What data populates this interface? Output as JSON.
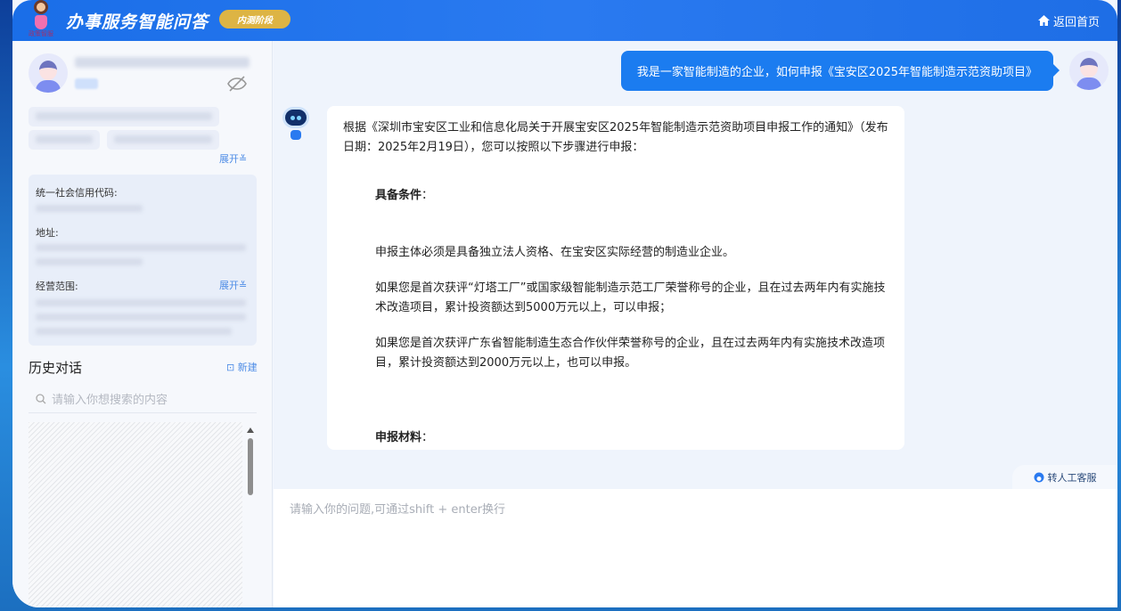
{
  "header": {
    "logo_text": "政策智服",
    "title": "办事服务智能问答",
    "badge": "内测阶段",
    "home_label": "返回首页"
  },
  "sidebar": {
    "credit_code_label": "统一社会信用代码:",
    "address_label": "地址:",
    "scope_label": "经营范围:",
    "expand_label": "展开",
    "history_title": "历史对话",
    "new_label": "新建",
    "search_placeholder": "请输入你想搜索的内容"
  },
  "chat": {
    "user_message": "我是一家智能制造的企业，如何申报《宝安区2025年智能制造示范资助项目》",
    "answer": {
      "intro": "根据《深圳市宝安区工业和信息化局关于开展宝安区2025年智能制造示范资助项目申报工作的通知》（发布日期：2025年2月19日），您可以按照以下步骤进行申报：",
      "section1_title": "具备条件",
      "section1_colon": "：",
      "p1": "申报主体必须是具备独立法人资格、在宝安区实际经营的制造业企业。",
      "p2": "如果您是首次获评“灯塔工厂”或国家级智能制造示范工厂荣誉称号的企业，且在过去两年内有实施技术改造项目，累计投资额达到5000万元以上，可以申报；",
      "p3": "如果您是首次获评广东省智能制造生态合作伙伴荣誉称号的企业，且在过去两年内有实施技术改造项目，累计投资额达到2000万元以上，也可以申报。",
      "section2_title": "申报材料",
      "section2_colon": "："
    },
    "human_service": "转人工客服",
    "input_placeholder": "请输入你的问题,可通过shift + enter换行"
  }
}
